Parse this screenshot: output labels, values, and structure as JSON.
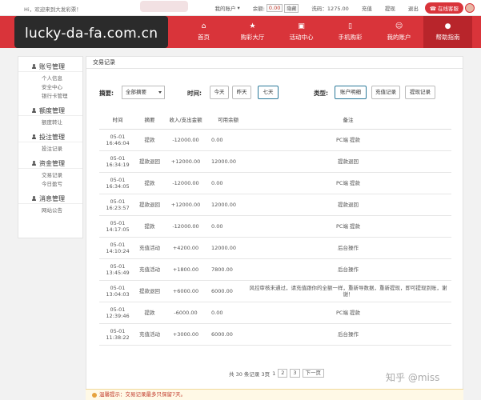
{
  "topbar": {
    "greeting": "Hi，欢迎来到大发彩票！",
    "my_account": "我的账户",
    "balance_label": "余额:",
    "balance_value": "0.00",
    "hide_label": "隐藏",
    "credit": "洗码：1275.00",
    "deposit": "充值",
    "withdraw": "提现",
    "logout": "退出",
    "customer_service": "在线客服"
  },
  "logo": {
    "text": "lucky-da-fa.com.cn"
  },
  "nav": {
    "items": [
      {
        "label": "首页",
        "icon": "home-icon"
      },
      {
        "label": "购彩大厅",
        "icon": "star-icon"
      },
      {
        "label": "活动中心",
        "icon": "gift-icon"
      },
      {
        "label": "手机购彩",
        "icon": "mobile-icon"
      },
      {
        "label": "我的账户",
        "icon": "user-icon"
      },
      {
        "label": "帮助指南",
        "icon": "help-icon"
      }
    ],
    "active_index": 5
  },
  "sidebar": {
    "groups": [
      {
        "title": "账号管理",
        "links": [
          "个人信息",
          "安全中心",
          "银行卡管理"
        ]
      },
      {
        "title": "额度管理",
        "links": [
          "额度转让"
        ]
      },
      {
        "title": "投注管理",
        "links": [
          "投注记录"
        ]
      },
      {
        "title": "资金管理",
        "links": [
          "交易记录",
          "今日盈亏"
        ]
      },
      {
        "title": "消息管理",
        "links": [
          "网站公告"
        ]
      }
    ]
  },
  "main": {
    "title": "交易记录",
    "filters": {
      "summary_label": "摘要:",
      "summary_value": "全部摘要",
      "time_label": "时间:",
      "time_options": [
        "今天",
        "昨天",
        "七天"
      ],
      "time_selected": 2,
      "type_label": "类型:",
      "type_options": [
        "账户明细",
        "充值记录",
        "提现记录"
      ],
      "type_selected": 0
    },
    "table": {
      "headers": [
        "时间",
        "摘要",
        "收入/支出金额",
        "可用余额",
        "备注"
      ],
      "rows": [
        [
          "05-01 16:46:04",
          "提款",
          "-12000.00",
          "0.00",
          "PC端 提款"
        ],
        [
          "05-01 16:34:19",
          "提款退回",
          "+12000.00",
          "12000.00",
          "提款退回"
        ],
        [
          "05-01 16:34:05",
          "提款",
          "-12000.00",
          "0.00",
          "PC端 提款"
        ],
        [
          "05-01 16:23:57",
          "提款退回",
          "+12000.00",
          "12000.00",
          "提款退回"
        ],
        [
          "05-01 14:17:05",
          "提款",
          "-12000.00",
          "0.00",
          "PC端 提款"
        ],
        [
          "05-01 14:10:24",
          "充值活动",
          "+4200.00",
          "12000.00",
          "后台操作"
        ],
        [
          "05-01 13:45:49",
          "充值活动",
          "+1800.00",
          "7800.00",
          "后台操作"
        ],
        [
          "05-01 13:04:03",
          "提款退回",
          "+6000.00",
          "6000.00",
          "风控审核未通过，请充值跟你的全额一样，重新导数据，重新提现，即可提现到账，谢谢！"
        ],
        [
          "05-01 12:39:46",
          "提款",
          "-6000.00",
          "0.00",
          "PC端 提款"
        ],
        [
          "05-01 11:38:22",
          "充值活动",
          "+3000.00",
          "6000.00",
          "后台操作"
        ]
      ]
    },
    "pager": {
      "summary": "共 30 条记录 3页",
      "pages": [
        "1",
        "2",
        "3"
      ],
      "next": "下一页"
    }
  },
  "watermark": "知乎 @miss",
  "notice": "温馨提示：交易记录最多只保留7天。",
  "colors": {
    "brand_red": "#d9343a",
    "nav_active": "#b8252b",
    "selected_border": "#2c7a9a"
  }
}
